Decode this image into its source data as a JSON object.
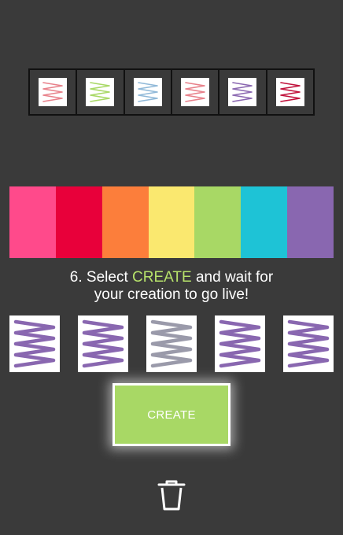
{
  "history": [
    {
      "color": "#e8808a"
    },
    {
      "color": "#a8d865"
    },
    {
      "color": "#8fb8d8"
    },
    {
      "color": "#e8808a"
    },
    {
      "color": "#8a66b0"
    },
    {
      "color": "#c0103a"
    }
  ],
  "palette": [
    {
      "name": "pink",
      "color": "#ff4a8b"
    },
    {
      "name": "red",
      "color": "#e8003a"
    },
    {
      "name": "orange",
      "color": "#fc7e3b"
    },
    {
      "name": "yellow",
      "color": "#fae86f"
    },
    {
      "name": "green",
      "color": "#a8d865"
    },
    {
      "name": "cyan",
      "color": "#1ec3d6"
    },
    {
      "name": "purple",
      "color": "#8967b0"
    }
  ],
  "instruction": {
    "before": "6. Select ",
    "highlight": "CREATE",
    "after": " and wait for",
    "line2": "your creation to go live!"
  },
  "options": [
    {
      "color": "#8967b0"
    },
    {
      "color": "#8967b0"
    },
    {
      "color": "#9a9aaa"
    },
    {
      "color": "#8967b0"
    },
    {
      "color": "#8967b0"
    }
  ],
  "create_label": "CREATE",
  "icons": {
    "delete": "trash-icon",
    "zigzag": "zigzag-icon"
  }
}
